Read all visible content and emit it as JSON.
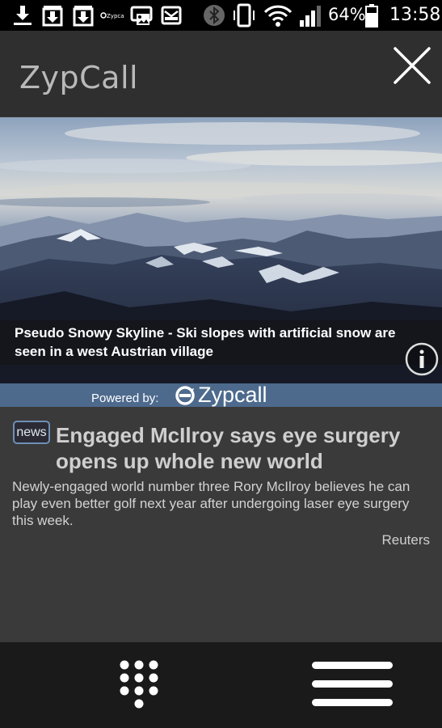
{
  "status_bar": {
    "battery": "64%",
    "time": "13:58",
    "notif_zypcall_text": "Zypcall",
    "icons": [
      "download-icon",
      "download-box-icon",
      "download-box-icon",
      "zypcall-icon",
      "gallery-icon",
      "mail-icon",
      "bluetooth-icon",
      "vibrate-icon",
      "wifi-icon",
      "signal-icon",
      "battery-icon"
    ]
  },
  "app_bar": {
    "title": "ZypCall",
    "close_icon": "close-icon"
  },
  "hero": {
    "caption": "Pseudo Snowy Skyline - Ski slopes with artificial snow are seen in a west Austrian village",
    "info_icon": "info-icon"
  },
  "powered": {
    "label": "Powered by:",
    "brand": "Zypcall"
  },
  "article": {
    "badge": "news",
    "headline": "Engaged McIlroy says eye surgery opens up whole new world",
    "summary": "Newly-engaged world number three Rory McIlroy believes he can play even better golf next year after undergoing laser eye surgery this week.",
    "source": "Reuters"
  },
  "bottom_bar": {
    "dialpad_icon": "dialpad-icon",
    "menu_icon": "menu-icon"
  },
  "colors": {
    "status_bg": "#000000",
    "app_bar_bg": "#2f2f2f",
    "content_bg": "#3a3a3a",
    "powered_bg": "#4d6a8d",
    "bottom_bg": "#1a1a1a"
  }
}
